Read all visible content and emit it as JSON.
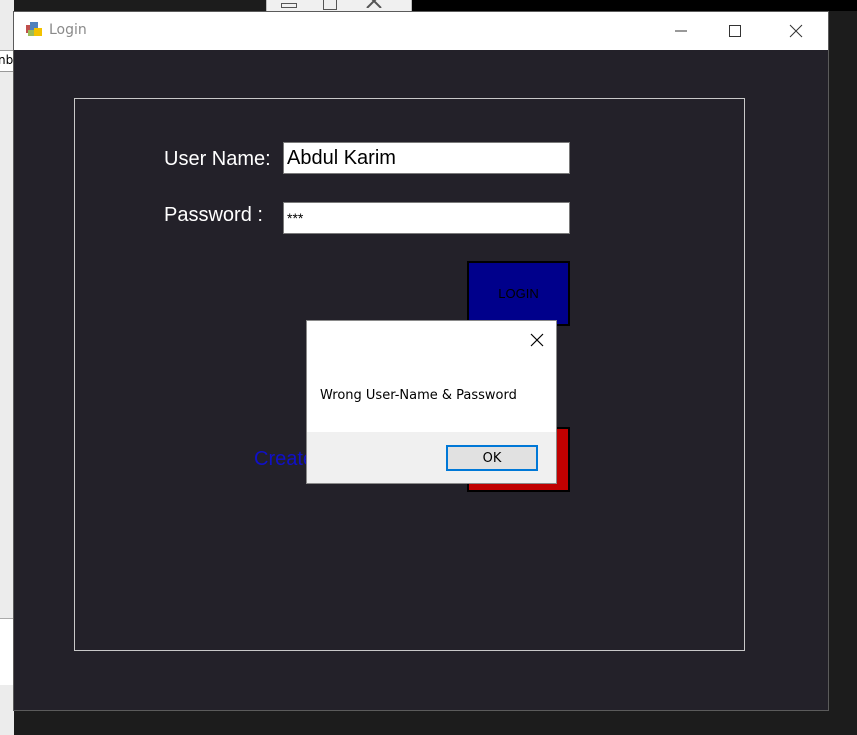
{
  "window": {
    "title": "Login"
  },
  "form": {
    "username_label": "User Name:",
    "username_value": "Abdul Karim",
    "password_label": "Password :",
    "password_value": "***",
    "login_button": "LOGIN",
    "create_link": "Create"
  },
  "messagebox": {
    "text": "Wrong User-Name & Password",
    "ok_label": "OK"
  },
  "background": {
    "partial_text": "nbe"
  },
  "colors": {
    "form_bg": "#232129",
    "login_button": "#00008b",
    "red_button": "#c00000",
    "link": "#1010c8",
    "focus": "#0078d7"
  }
}
